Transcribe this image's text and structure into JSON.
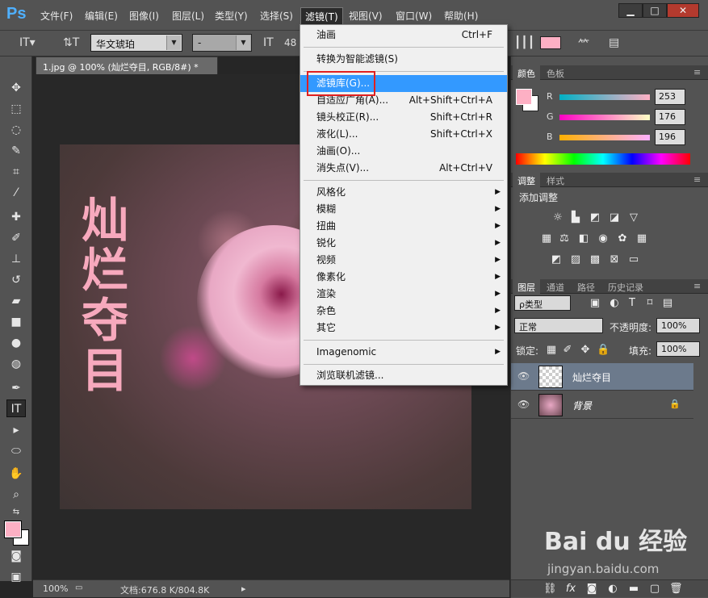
{
  "menubar": {
    "logo": "Ps",
    "items": [
      "文件(F)",
      "编辑(E)",
      "图像(I)",
      "图层(L)",
      "类型(Y)",
      "选择(S)",
      "滤镜(T)",
      "视图(V)",
      "窗口(W)",
      "帮助(H)"
    ],
    "window_buttons": [
      "▁",
      "□",
      "✕"
    ]
  },
  "options": {
    "font_family": "华文琥珀",
    "font_style": "-",
    "font_size": "48"
  },
  "document": {
    "tab_title": "1.jpg @ 100% (灿烂夺目, RGB/8#) *",
    "canvas_text": "灿烂夺目",
    "status_zoom": "100%",
    "status_doc": "文档:676.8 K/804.8K"
  },
  "filter_menu": {
    "items": [
      {
        "label": "油画",
        "shortcut": "Ctrl+F"
      },
      {
        "label": "转换为智能滤镜(S)"
      },
      {
        "label": "滤镜库(G)...",
        "highlight": true
      },
      {
        "label": "自适应广角(A)...",
        "shortcut": "Alt+Shift+Ctrl+A"
      },
      {
        "label": "镜头校正(R)...",
        "shortcut": "Shift+Ctrl+R"
      },
      {
        "label": "液化(L)...",
        "shortcut": "Shift+Ctrl+X"
      },
      {
        "label": "油画(O)..."
      },
      {
        "label": "消失点(V)...",
        "shortcut": "Alt+Ctrl+V"
      },
      {
        "label": "风格化",
        "submenu": true
      },
      {
        "label": "模糊",
        "submenu": true
      },
      {
        "label": "扭曲",
        "submenu": true
      },
      {
        "label": "锐化",
        "submenu": true
      },
      {
        "label": "视频",
        "submenu": true
      },
      {
        "label": "像素化",
        "submenu": true
      },
      {
        "label": "渲染",
        "submenu": true
      },
      {
        "label": "杂色",
        "submenu": true
      },
      {
        "label": "其它",
        "submenu": true
      },
      {
        "label": "Imagenomic",
        "submenu": true
      },
      {
        "label": "浏览联机滤镜..."
      }
    ]
  },
  "color_panel": {
    "tabs": [
      "颜色",
      "色板"
    ],
    "r_label": "R",
    "g_label": "G",
    "b_label": "B",
    "r": 253,
    "g": 176,
    "b": 196
  },
  "adjust_panel": {
    "tabs": [
      "调整",
      "样式"
    ],
    "title": "添加调整"
  },
  "layers_panel": {
    "tabs": [
      "图层",
      "通道",
      "路径",
      "历史记录"
    ],
    "filter_kind": "ρ类型",
    "blend_mode": "正常",
    "opacity_label": "不透明度:",
    "opacity": "100%",
    "lock_label": "锁定:",
    "fill_label": "填充:",
    "fill": "100%",
    "layers": [
      {
        "name": "灿烂夺目",
        "selected": true
      },
      {
        "name": "背景",
        "locked": true
      }
    ],
    "footer_icons": [
      "link-icon",
      "fx-icon",
      "mask-icon",
      "adjustment-icon",
      "folder-icon",
      "new-layer-icon",
      "trash-icon"
    ]
  },
  "watermark": {
    "logo": "Bai du 经验",
    "sub": "jingyan.baidu.com"
  },
  "colors": {
    "menu_highlight": "#3399ff",
    "swatch_fg": "#fdb0c4",
    "canvas_text": "#f7a9bd",
    "annotation_red": "#e02020"
  }
}
